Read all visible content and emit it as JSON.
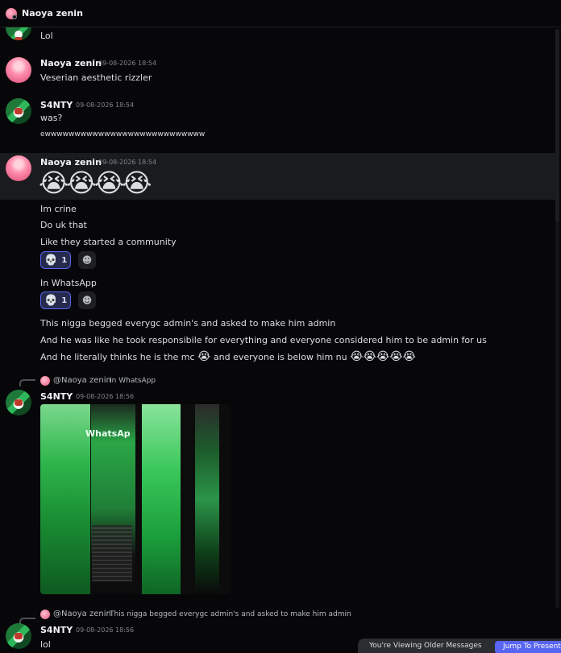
{
  "header": {
    "channel_name": "Naoya zenin",
    "avatar_icon": "naoya-avatar-icon"
  },
  "messages": [
    {
      "author": "",
      "lines": [
        "Lol"
      ]
    },
    {
      "author": "Naoya zenin",
      "timestamp": "09-08-2026 18:54",
      "lines": [
        "Veserian aesthetic rizzler"
      ]
    },
    {
      "author": "S4NTY",
      "timestamp": "09-08-2026 18:54",
      "lines": [
        "was?",
        "ewwwwwwwwwwwwwwwwwwwwwwwwwww"
      ]
    },
    {
      "author": "Naoya zenin",
      "timestamp": "09-08-2026 18:54",
      "big_emoji": "😭😭😭😭",
      "lines": [
        "Im crine",
        "Do uk that",
        "Like they started a community",
        "In WhatsApp",
        "This nigga begged everygc admin's and asked to make him admin",
        "And he was like he took responsibile for everything and everyone considered him to be admin for us"
      ],
      "line7_prefix": "And he literally thinks he is the mc",
      "line7_emoji": "😭",
      "line7_mid": " and everyone is below him nu ",
      "line7_trailing": "😭😭😭😭😭",
      "reactions": [
        {
          "emoji": "💀",
          "count": "1",
          "add_icon": "☻"
        },
        {
          "emoji": "💀",
          "count": "1",
          "add_icon": "☻"
        }
      ]
    },
    {
      "reply_to": {
        "mention": "@Naoya zenin",
        "text": "In WhatsApp"
      },
      "author": "S4NTY",
      "timestamp": "09-08-2026 18:56",
      "attachment": "image",
      "image_sign_text": "WhatsAp"
    },
    {
      "reply_to": {
        "mention": "@Naoya zenin",
        "text": "This nigga begged everygc admin's and asked to make him admin"
      },
      "author": "S4NTY",
      "timestamp": "09-08-2026 18:56",
      "lines": [
        "lol"
      ]
    }
  ],
  "banner": {
    "text": "You're Viewing Older Messages",
    "button": "Jump To Present"
  },
  "colors": {
    "background": "#070709",
    "highlight": "#1a1b1e",
    "accent": "#5865f2"
  }
}
